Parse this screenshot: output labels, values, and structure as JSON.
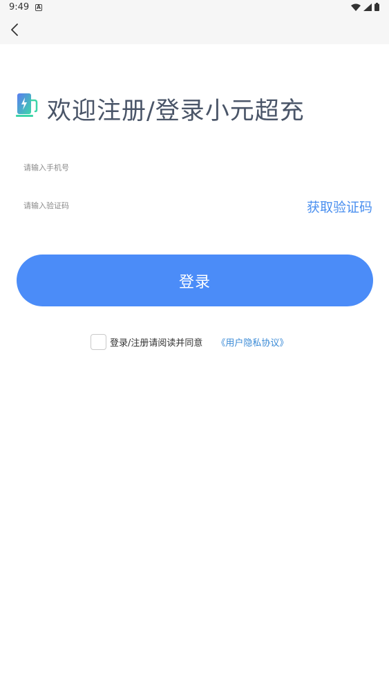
{
  "status_bar": {
    "time": "9:49",
    "notification_letter": "A"
  },
  "header": {
    "title": "欢迎注册/登录小元超充"
  },
  "form": {
    "phone_placeholder": "请输入手机号",
    "code_placeholder": "请输入验证码",
    "get_code_label": "获取验证码",
    "login_label": "登录"
  },
  "agreement": {
    "text": "登录/注册请阅读并同意",
    "link_label": "《用户隐私协议》"
  },
  "colors": {
    "accent": "#4b8cf8",
    "link": "#3a8ad6",
    "title": "#4a5568"
  }
}
